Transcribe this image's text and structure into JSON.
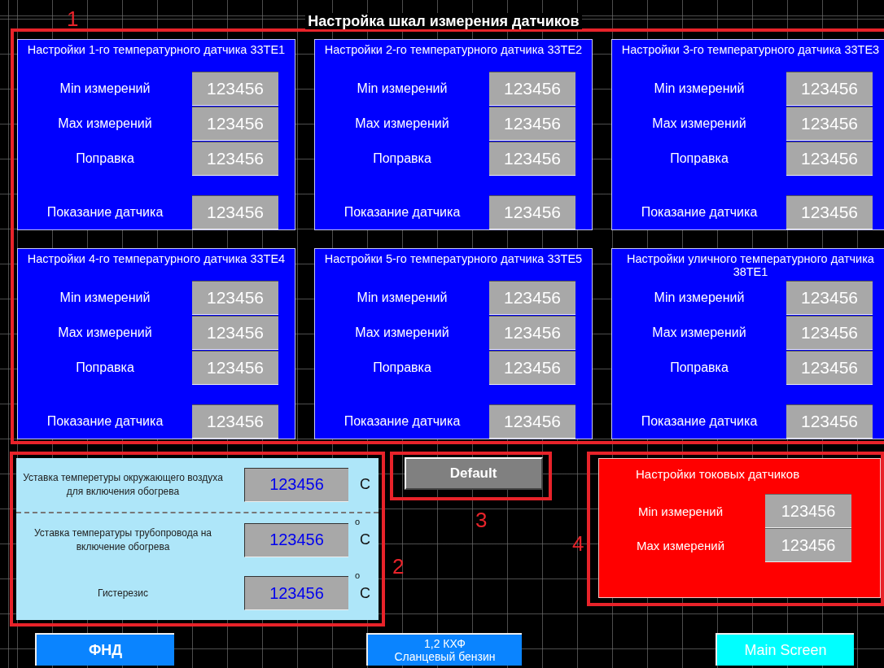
{
  "title": "Настройка шкал измерения датчиков",
  "annotations": [
    "1",
    "2",
    "3",
    "4"
  ],
  "sensor_panels": [
    {
      "title": "Настройки 1-го температурного датчика 33TE1",
      "rows": [
        {
          "kind": "setting",
          "label": "Min измерений",
          "value": "123456"
        },
        {
          "kind": "setting",
          "label": "Max измерений",
          "value": "123456"
        },
        {
          "kind": "setting",
          "label": "Поправка",
          "value": "123456"
        },
        {
          "kind": "reading",
          "label": "Показание датчика",
          "value": "123456"
        }
      ]
    },
    {
      "title": "Настройки 2-го температурного датчика 33TE2",
      "rows": [
        {
          "kind": "setting",
          "label": "Min измерений",
          "value": "123456"
        },
        {
          "kind": "setting",
          "label": "Max измерений",
          "value": "123456"
        },
        {
          "kind": "setting",
          "label": "Поправка",
          "value": "123456"
        },
        {
          "kind": "reading",
          "label": "Показание датчика",
          "value": "123456"
        }
      ]
    },
    {
      "title": "Настройки 3-го температурного датчика 33TE3",
      "rows": [
        {
          "kind": "setting",
          "label": "Min измерений",
          "value": "123456"
        },
        {
          "kind": "setting",
          "label": "Max измерений",
          "value": "123456"
        },
        {
          "kind": "setting",
          "label": "Поправка",
          "value": "123456"
        },
        {
          "kind": "reading",
          "label": "Показание датчика",
          "value": "123456"
        }
      ]
    },
    {
      "title": "Настройки 4-го температурного датчика 33TE4",
      "rows": [
        {
          "kind": "setting",
          "label": "Min измерений",
          "value": "123456"
        },
        {
          "kind": "setting",
          "label": "Max измерений",
          "value": "123456"
        },
        {
          "kind": "setting",
          "label": "Поправка",
          "value": "123456"
        },
        {
          "kind": "reading",
          "label": "Показание датчика",
          "value": "123456"
        }
      ]
    },
    {
      "title": "Настройки 5-го температурного датчика 33TE5",
      "rows": [
        {
          "kind": "setting",
          "label": "Min измерений",
          "value": "123456"
        },
        {
          "kind": "setting",
          "label": "Max измерений",
          "value": "123456"
        },
        {
          "kind": "setting",
          "label": "Поправка",
          "value": "123456"
        },
        {
          "kind": "reading",
          "label": "Показание датчика",
          "value": "123456"
        }
      ]
    },
    {
      "title": "Настройки уличного температурного датчика 38TE1",
      "rows": [
        {
          "kind": "setting",
          "label": "Min измерений",
          "value": "123456"
        },
        {
          "kind": "setting",
          "label": "Max измерений",
          "value": "123456"
        },
        {
          "kind": "setting",
          "label": "Поправка",
          "value": "123456"
        },
        {
          "kind": "reading",
          "label": "Показание датчика",
          "value": "123456"
        }
      ]
    }
  ],
  "heating_panel": {
    "rows": [
      {
        "label": "Уставка темпeретуры окружающего воздуха для включения обогрева",
        "value": "123456",
        "unit": "C"
      },
      {
        "label": "Уставка темпeратуры трубопровода на включение обогрева",
        "value": "123456",
        "degree": "o",
        "unit": "C"
      },
      {
        "label": "Гистерезис",
        "value": "123456",
        "degree": "o",
        "unit": "C"
      }
    ]
  },
  "default_button": "Default",
  "current_panel": {
    "title": "Настройки токовых датчиков",
    "rows": [
      {
        "label": "Min измерений",
        "value": "123456"
      },
      {
        "label": "Max измерений",
        "value": "123456"
      }
    ]
  },
  "nav_buttons": [
    {
      "kind": "blue",
      "lines": [
        "ФНД"
      ]
    },
    {
      "kind": "blue",
      "lines": [
        "1,2 КХФ",
        "Сланцевый бензин"
      ]
    },
    {
      "kind": "cyan",
      "lines": [
        "Main Screen"
      ]
    }
  ]
}
